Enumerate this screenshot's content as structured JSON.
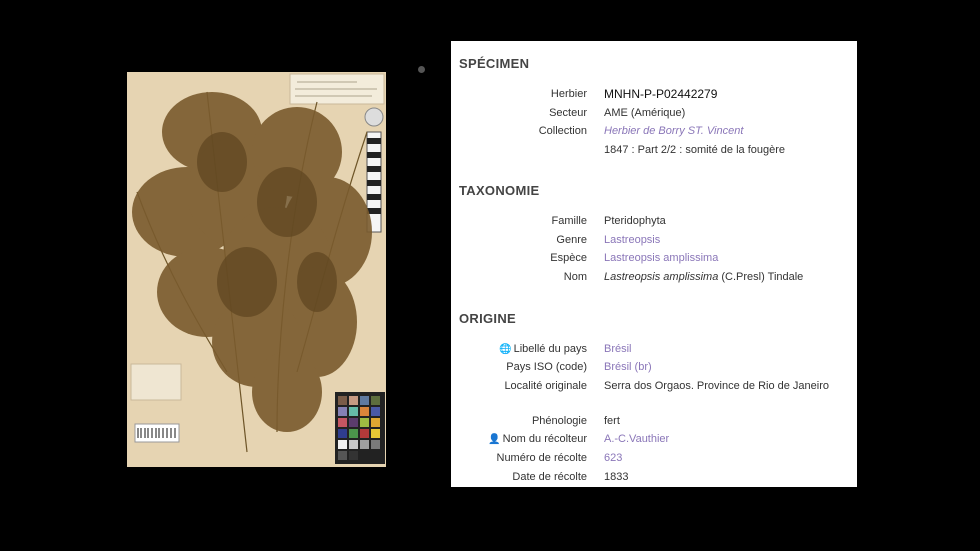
{
  "specimen": {
    "title": "SPÉCIMEN",
    "herbier_label": "Herbier",
    "herbier_value": "MNHN-P-P02442279",
    "secteur_label": "Secteur",
    "secteur_value": "AME (Amérique)",
    "collection_label": "Collection",
    "collection_value": "Herbier de Borry ST. Vincent",
    "note": "1847 : Part 2/2 : somité de la fougère"
  },
  "taxonomie": {
    "title": "TAXONOMIE",
    "famille_label": "Famille",
    "famille_value": "Pteridophyta",
    "genre_label": "Genre",
    "genre_value": "Lastreopsis",
    "espece_label": "Espèce",
    "espece_value": "Lastreopsis amplissima",
    "nom_label": "Nom",
    "nom_value_italic": "Lastreopsis amplissima",
    "nom_value_rest": " (C.Presl) Tindale"
  },
  "origine": {
    "title": "ORIGINE",
    "pays_label": "Libellé du pays",
    "pays_value": "Brésil",
    "iso_label": "Pays ISO (code)",
    "iso_value": "Brésil (br)",
    "localite_label": "Localité originale",
    "localite_value": "Serra dos Orgaos. Province de Rio de Janeiro",
    "phenologie_label": "Phénologie",
    "phenologie_value": "fert",
    "recolteur_label": "Nom du récolteur",
    "recolteur_value": "A.-C.Vauthier",
    "numero_label": "Numéro de récolte",
    "numero_value": "623",
    "date_label": "Date de récolte",
    "date_value": "1833"
  },
  "icons": {
    "globe": "globe-icon",
    "person": "person-icon"
  }
}
